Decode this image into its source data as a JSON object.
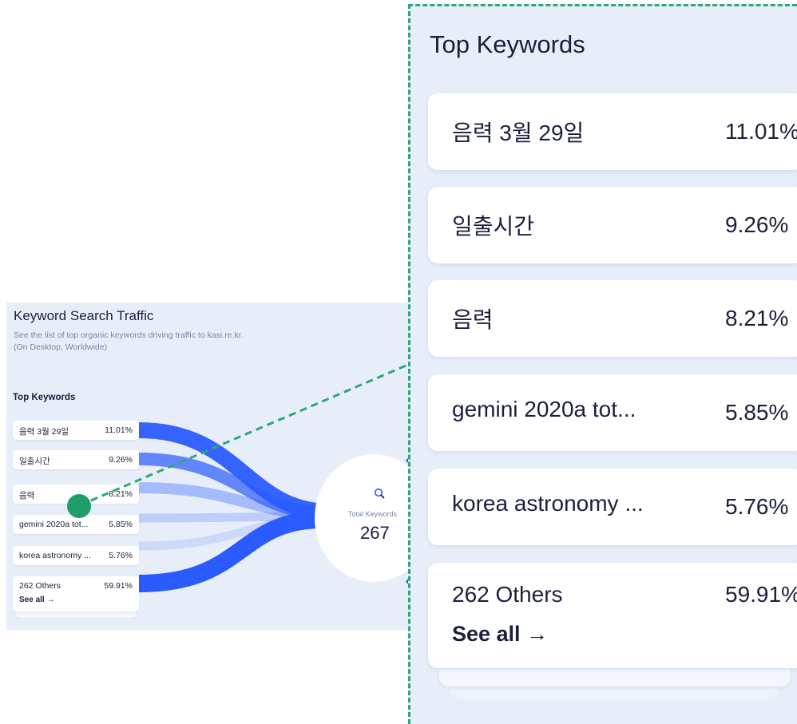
{
  "widget": {
    "title": "Keyword Search Traffic",
    "subtitle_line1": "See the list of top organic keywords driving traffic to kasi.re.kr.",
    "subtitle_line2": "(On Desktop, Worldwide)",
    "section_title": "Top Keywords",
    "keywords": [
      {
        "name": "음력 3월 29일",
        "share": "11.01%"
      },
      {
        "name": "일출시간",
        "share": "9.26%"
      },
      {
        "name": "음력",
        "share": "8.21%"
      },
      {
        "name": "gemini 2020a tot...",
        "share": "5.85%"
      },
      {
        "name": "korea astronomy ...",
        "share": "5.76%"
      }
    ],
    "others": {
      "name": "262 Others",
      "share": "59.91%",
      "see_all": "See all →"
    },
    "total": {
      "label": "Total Keywords",
      "value": "267"
    }
  },
  "colors": {
    "background": "#e8eef9",
    "flow_blue": "#2a5bff",
    "callout_green": "#2ea778",
    "text": "#1b1f3b",
    "muted": "#7a84a6"
  },
  "icons": {
    "hub": "search-icon"
  }
}
